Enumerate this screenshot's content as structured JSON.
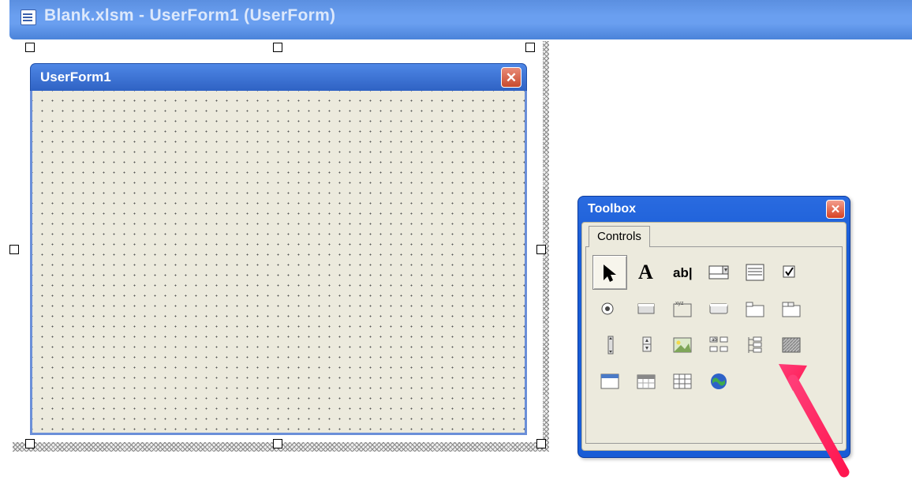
{
  "mdi": {
    "title": "Blank.xlsm - UserForm1 (UserForm)"
  },
  "userform": {
    "title": "UserForm1",
    "close_glyph": "✕"
  },
  "toolbox": {
    "title": "Toolbox",
    "close_glyph": "✕",
    "tab_label": "Controls",
    "tools": [
      {
        "id": "pointer",
        "name": "Select Objects",
        "sel": true
      },
      {
        "id": "label",
        "name": "Label"
      },
      {
        "id": "textbox",
        "name": "TextBox"
      },
      {
        "id": "combobox",
        "name": "ComboBox"
      },
      {
        "id": "listbox",
        "name": "ListBox"
      },
      {
        "id": "checkbox",
        "name": "CheckBox"
      },
      {
        "id": "option",
        "name": "OptionButton"
      },
      {
        "id": "toggle",
        "name": "ToggleButton"
      },
      {
        "id": "frame",
        "name": "Frame"
      },
      {
        "id": "command",
        "name": "CommandButton"
      },
      {
        "id": "tabstrip",
        "name": "TabStrip"
      },
      {
        "id": "multipage",
        "name": "MultiPage"
      },
      {
        "id": "scrollbar",
        "name": "ScrollBar"
      },
      {
        "id": "spin",
        "name": "SpinButton"
      },
      {
        "id": "image",
        "name": "Image"
      },
      {
        "id": "refedit",
        "name": "RefEdit"
      },
      {
        "id": "treeview",
        "name": "TreeView"
      },
      {
        "id": "ole",
        "name": "MoreControls"
      },
      {
        "id": "webbrowser",
        "name": "WebBrowser"
      },
      {
        "id": "date",
        "name": "DatePicker"
      },
      {
        "id": "grid",
        "name": "DataGrid"
      },
      {
        "id": "globe",
        "name": "InternetControl"
      }
    ]
  }
}
